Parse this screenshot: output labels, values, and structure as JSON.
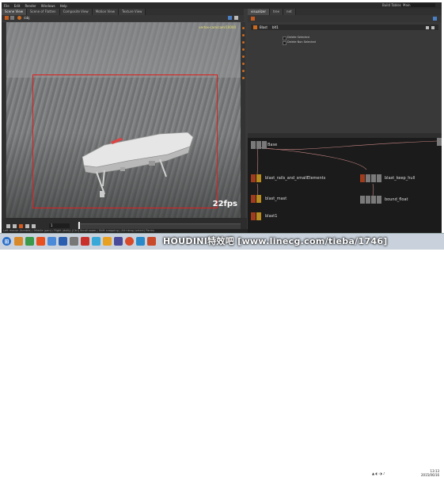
{
  "menu": {
    "items": [
      "File",
      "Edit",
      "Render",
      "Windows",
      "Help"
    ],
    "desktop_label": "Build Tables",
    "desktop_value": "Main"
  },
  "scene_tabs": [
    "Scene View",
    "Scene of Flatten",
    "Composite View",
    "Motion View",
    "Texture View"
  ],
  "viewport": {
    "camera_label": "vertex-cam/cam/10000",
    "fps": "22fps",
    "object_path": "/obj"
  },
  "timeline": {
    "frame": "1"
  },
  "status_text": "Left mouse (tumble) / Middle (pan) / Right (dolly) [Ctrl] Scroll zoom | Shift snapping | Alt+drag (select) Parms",
  "right_tabs": [
    "visualizer",
    "tree",
    "net"
  ],
  "params": {
    "node_type": "Blast",
    "node_name": "blt1",
    "checkbox1": "Delete Selected",
    "checkbox2": "Delete Non Selected"
  },
  "nodes": [
    {
      "label": "Base"
    },
    {
      "label": "blast_rails_and_smallElements"
    },
    {
      "label": "blast_keep_hull"
    },
    {
      "label": "blast_mast"
    },
    {
      "label": "bound_float"
    },
    {
      "label": "blast1"
    }
  ],
  "watermark": "HOUDINI特效吧 [www.linecg.com/tieba/1746]",
  "clock": {
    "time": "13:13",
    "date": "2015/06/16"
  },
  "colors": {
    "frame_red": "#e02020",
    "node_red": "#a03c1e",
    "panel_bg": "#3a3a3a",
    "network_bg": "#1b1b1b"
  }
}
